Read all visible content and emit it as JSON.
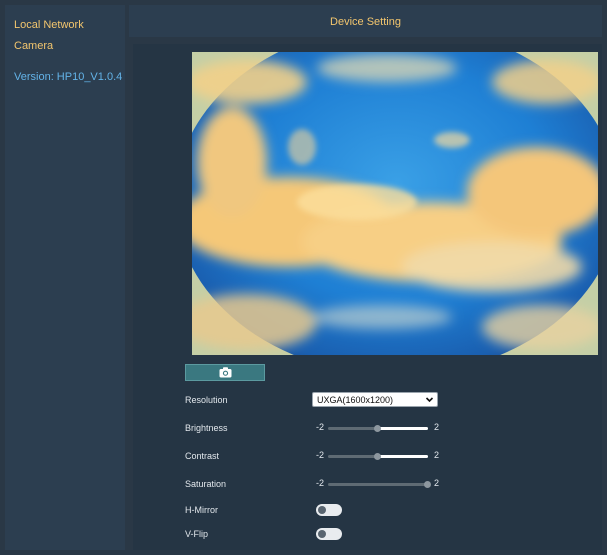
{
  "sidebar": {
    "items": [
      {
        "label": "Local Network"
      },
      {
        "label": "Camera"
      }
    ],
    "version": "Version: HP10_V1.0.4"
  },
  "header": {
    "title": "Device Setting"
  },
  "snapshot": {
    "icon": "camera-icon"
  },
  "resolution": {
    "label": "Resolution",
    "selected": "UXGA(1600x1200)"
  },
  "brightness": {
    "label": "Brightness",
    "min": "-2",
    "max": "2",
    "value": 0
  },
  "contrast": {
    "label": "Contrast",
    "min": "-2",
    "max": "2",
    "value": 0
  },
  "saturation": {
    "label": "Saturation",
    "min": "-2",
    "max": "2",
    "value": 2
  },
  "h_mirror": {
    "label": "H-Mirror",
    "on": false
  },
  "v_flip": {
    "label": "V-Flip",
    "on": false
  },
  "colors": {
    "accent": "#f3c66e",
    "version": "#63b3e8",
    "button": "#3a7880"
  }
}
